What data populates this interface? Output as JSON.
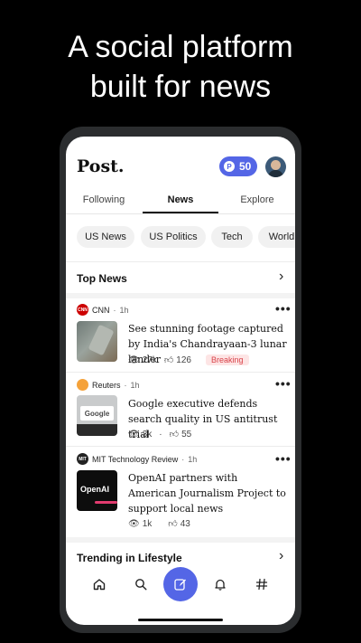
{
  "headline": [
    "A social platform",
    "built for news"
  ],
  "app": {
    "logo": "Post.",
    "coins": "50",
    "coin_symbol": "P"
  },
  "tabs": [
    {
      "label": "Following"
    },
    {
      "label": "News"
    },
    {
      "label": "Explore"
    }
  ],
  "active_tab": "News",
  "chips": [
    "US News",
    "US Politics",
    "Tech",
    "World"
  ],
  "top_news": {
    "title": "Top News"
  },
  "stories": [
    {
      "source": "CNN",
      "time": "1h",
      "headline": "See stunning footage captured by India's Chandrayaan-3 lunar lander",
      "views": "27k",
      "likes": "126",
      "badge": "Breaking"
    },
    {
      "source": "Reuters",
      "time": "1h",
      "headline": "Google executive defends search quality in US antitrust trial",
      "views": "3k",
      "likes": "55"
    },
    {
      "source": "MIT Technology Review",
      "time": "1h",
      "headline": "OpenAI partners with American Journalism Project to support local news",
      "views": "1k",
      "likes": "43"
    }
  ],
  "thumb_text": {
    "google": "Google",
    "openai": "OpenAI"
  },
  "trending": {
    "title": "Trending in Lifestyle"
  },
  "meta_separator": "·",
  "colors": {
    "accent": "#5466e6",
    "breaking_text": "#d9434a",
    "breaking_bg": "#fde5e5"
  },
  "nav": [
    "home-icon",
    "search-icon",
    "compose-icon",
    "bell-icon",
    "hashtag-icon"
  ]
}
